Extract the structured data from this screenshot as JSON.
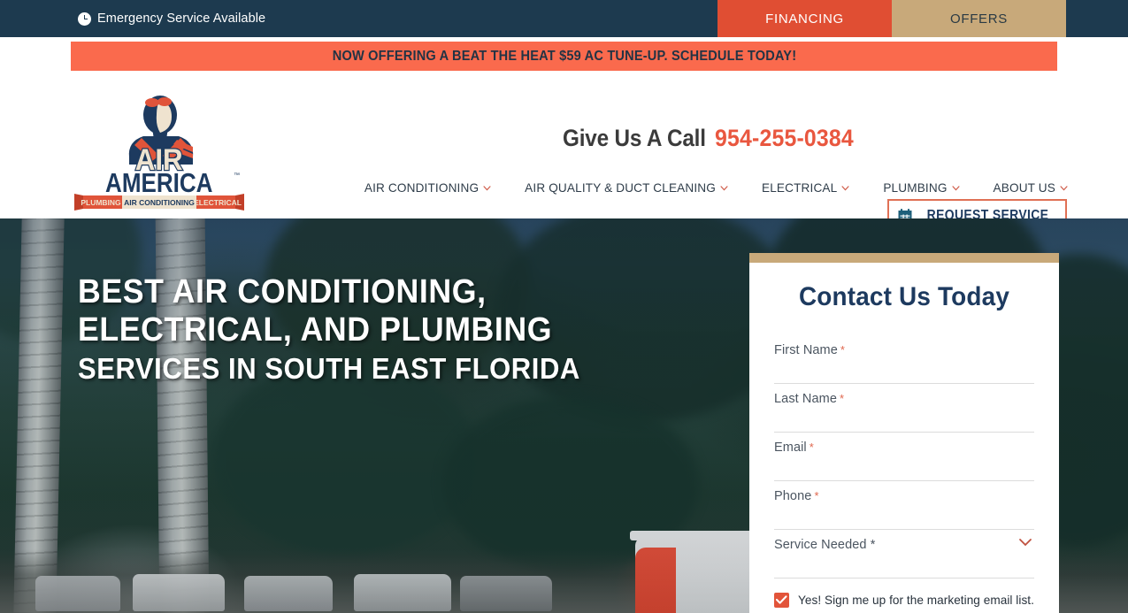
{
  "topbar": {
    "emergency_text": "Emergency Service Available",
    "clock_icon": "clock-icon",
    "financing_label": "FINANCING",
    "offers_label": "OFFERS",
    "financing_color": "#e04e33",
    "offers_color": "#c8a97a",
    "background_color": "#1d3a4f"
  },
  "promo": {
    "text": "NOW OFFERING A BEAT THE HEAT $59 AC TUNE-UP. SCHEDULE TODAY!",
    "background_color": "#fa6a4d",
    "text_color": "#223344"
  },
  "header": {
    "logo": {
      "primary_text": "AIR",
      "secondary_text": "AMERICA",
      "trademark": "™",
      "banner_left": "PLUMBING",
      "banner_center": "AIR CONDITIONING",
      "banner_right": "ELECTRICAL",
      "navy": "#1d3a5f",
      "red": "#e0543a",
      "cream": "#efe3cf"
    },
    "call_label": "Give Us A Call",
    "phone": "954-255-0384",
    "phone_color": "#e9573f",
    "request_button": {
      "label": "REQUEST SERVICE",
      "icon": "calendar-icon",
      "border_color": "#e07055",
      "text_color": "#1d3a5f"
    },
    "nav": [
      {
        "label": "AIR CONDITIONING",
        "has_dropdown": true
      },
      {
        "label": "AIR QUALITY & DUCT CLEANING",
        "has_dropdown": true
      },
      {
        "label": "ELECTRICAL",
        "has_dropdown": true
      },
      {
        "label": "PLUMBING",
        "has_dropdown": true
      },
      {
        "label": "ABOUT US",
        "has_dropdown": true
      }
    ]
  },
  "hero": {
    "heading_line1": "BEST AIR CONDITIONING,",
    "heading_line2": "ELECTRICAL, AND PLUMBING",
    "heading_line3": "SERVICES IN SOUTH EAST FLORIDA"
  },
  "form": {
    "accent_bar_color": "#c8a97a",
    "title": "Contact Us Today",
    "title_color": "#1d3a5f",
    "fields": [
      {
        "label": "First Name",
        "required": "*",
        "value": "",
        "type": "text"
      },
      {
        "label": "Last Name",
        "required": "*",
        "value": "",
        "type": "text"
      },
      {
        "label": "Email",
        "required": "*",
        "value": "",
        "type": "email"
      },
      {
        "label": "Phone",
        "required": "*",
        "value": "",
        "type": "tel"
      },
      {
        "label": "Service Needed *",
        "required": "",
        "value": "",
        "type": "select"
      }
    ],
    "checkbox": {
      "label": "Yes! Sign me up for the marketing email list.",
      "checked": true,
      "color": "#e2543a"
    }
  }
}
